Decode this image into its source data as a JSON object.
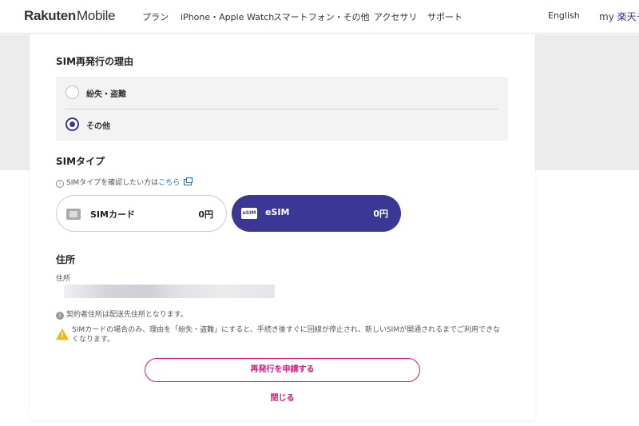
{
  "header": {
    "logo_brand": "Rakuten",
    "logo_product": "Mobile",
    "nav": [
      "プラン",
      "iPhone・Apple Watch",
      "スマートフォン・その他",
      "アクセサリ",
      "サポート"
    ],
    "language": "English",
    "my_link": "my 楽天モ"
  },
  "reason": {
    "title": "SIM再発行の理由",
    "options": [
      {
        "label": "紛失・盗難",
        "selected": false
      },
      {
        "label": "その他",
        "selected": true
      }
    ]
  },
  "sim_type": {
    "title": "SIMタイプ",
    "info_prefix": "SIMタイプを確認したい方は",
    "info_link": "こちら",
    "options": [
      {
        "icon": "sim-card-icon",
        "label": "SIMカード",
        "price": "0円",
        "selected": false
      },
      {
        "icon": "esim-icon",
        "icon_text": "eSIM",
        "label": "eSIM",
        "price": "0円",
        "selected": true
      }
    ]
  },
  "address": {
    "title": "住所",
    "field_label": "住所",
    "note": "契約者住所は配送先住所となります。"
  },
  "warning": {
    "text": "SIMカードの場合のみ、理由を「紛失・盗難」にすると、手続き後すぐに回線が停止され、新しいSIMが開通されるまでご利用できなくなります。"
  },
  "actions": {
    "submit": "再発行を申請する",
    "close": "閉じる"
  },
  "colors": {
    "primary": "#3b3794",
    "accent": "#d4197a",
    "warning": "#f0b41c"
  }
}
